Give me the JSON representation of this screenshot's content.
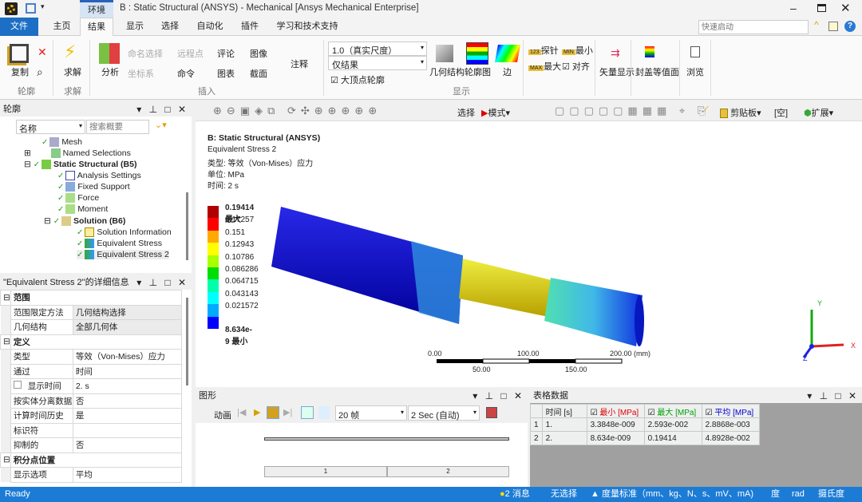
{
  "titlebar": {
    "context_tab": "环境",
    "title": "B : Static Structural (ANSYS) - Mechanical [Ansys Mechanical Enterprise]",
    "quick_launch_placeholder": "快速启动"
  },
  "tabs": [
    {
      "label": "文件"
    },
    {
      "label": "主页"
    },
    {
      "label": "结果",
      "active": true
    },
    {
      "label": "显示"
    },
    {
      "label": "选择"
    },
    {
      "label": "自动化"
    },
    {
      "label": "插件"
    },
    {
      "label": "学习和技术支持"
    }
  ],
  "ribbon": {
    "outline": {
      "copy": "复制",
      "group": "轮廓"
    },
    "solve": {
      "solve": "求解",
      "group": "求解"
    },
    "insert": {
      "analysis": "分析",
      "named_selection": "命名选择",
      "remote_point": "远程点",
      "comment": "评论",
      "image": "图像",
      "coordinate_system": "坐标系",
      "command": "命令",
      "chart": "图表",
      "section": "截面",
      "annotation": "注释",
      "group": "插入"
    },
    "display": {
      "scale": "1.0（真实尺度）",
      "result_mode": "仅结果",
      "large_vertex_contour": "大顶点轮廓",
      "geometry": "几何结构",
      "contour": "轮廓图",
      "edge": "边",
      "probe": "探针",
      "min": "最小",
      "max": "最大",
      "align": "对齐",
      "group": "显示"
    },
    "vector_display": "矢量显示",
    "capped_isosurface": "封盖等值面",
    "browse": "浏览"
  },
  "graphics_toolbar": {
    "select": "选择",
    "mode": "模式",
    "clipboard": "剪贴板",
    "empty": "[空]",
    "expand": "扩展"
  },
  "outline": {
    "title": "轮廓",
    "name_filter": "名称",
    "search_placeholder": "搜索概要",
    "items": [
      {
        "label": "Mesh"
      },
      {
        "label": "Named Selections"
      },
      {
        "label": "Static Structural (B5)"
      },
      {
        "label": "Analysis Settings"
      },
      {
        "label": "Fixed Support"
      },
      {
        "label": "Force"
      },
      {
        "label": "Moment"
      },
      {
        "label": "Solution (B6)"
      },
      {
        "label": "Solution Information"
      },
      {
        "label": "Equivalent Stress"
      },
      {
        "label": "Equivalent Stress 2"
      }
    ]
  },
  "details": {
    "title": "\"Equivalent Stress 2\"的详细信息",
    "rows": [
      {
        "section": "范围"
      },
      {
        "k": "范围限定方法",
        "v": "几何结构选择"
      },
      {
        "k": "几何结构",
        "v": "全部几何体"
      },
      {
        "section": "定义"
      },
      {
        "k": "类型",
        "v": "等效（Von-Mises）应力"
      },
      {
        "k": "通过",
        "v": "时间"
      },
      {
        "k": "显示时间",
        "v": "2. s"
      },
      {
        "k": "按实体分离数据",
        "v": "否"
      },
      {
        "k": "计算时间历史",
        "v": "是"
      },
      {
        "k": "标识符",
        "v": ""
      },
      {
        "k": "抑制的",
        "v": "否"
      },
      {
        "section": "积分点位置"
      },
      {
        "k": "显示选项",
        "v": "平均"
      }
    ]
  },
  "viewport": {
    "system": "B: Static Structural (ANSYS)",
    "result": "Equivalent Stress 2",
    "type": "类型: 等效（Von-Mises）应力",
    "unit": "单位: MPa",
    "time": "时间: 2 s",
    "legend": [
      {
        "v": "0.19414 最大",
        "c": "#b00000"
      },
      {
        "v": "0.17257",
        "c": "#ff0000"
      },
      {
        "v": "0.151",
        "c": "#ffaa00"
      },
      {
        "v": "0.12943",
        "c": "#ffff00"
      },
      {
        "v": "0.10786",
        "c": "#aaff00"
      },
      {
        "v": "0.086286",
        "c": "#00dd00"
      },
      {
        "v": "0.064715",
        "c": "#00ffaa"
      },
      {
        "v": "0.043143",
        "c": "#00ffff"
      },
      {
        "v": "0.021572",
        "c": "#00aaff"
      },
      {
        "v": "8.634e-9 最小",
        "c": "#0000ff"
      }
    ],
    "scale": {
      "top": [
        "0.00",
        "100.00",
        "200.00 (mm)"
      ],
      "bottom": [
        "50.00",
        "150.00"
      ]
    },
    "axes": {
      "x": "X",
      "y": "Y",
      "z": "Z"
    }
  },
  "graph": {
    "title": "图形",
    "animation": "动画",
    "frames": "20 帧",
    "duration": "2 Sec (自动)",
    "steps": [
      "1",
      "2"
    ]
  },
  "tabular": {
    "title": "表格数据",
    "headers": [
      "时间 [s]",
      "最小 [MPa]",
      "最大 [MPa]",
      "平均 [MPa]"
    ],
    "header_colors": [
      "#222222",
      "#dd0000",
      "#00a000",
      "#0000cc"
    ],
    "rows": [
      [
        "1",
        "1.",
        "3.3848e-009",
        "2.593e-002",
        "2.8868e-003"
      ],
      [
        "2",
        "2.",
        "8.634e-009",
        "0.19414",
        "4.8928e-002"
      ]
    ]
  },
  "status": {
    "ready": "Ready",
    "messages": "2 消息",
    "selection": "无选择",
    "units": "度量标准（mm、kg、N、s、mV、mA)",
    "deg": "度",
    "rad": "rad",
    "celsius": "摄氏度"
  }
}
